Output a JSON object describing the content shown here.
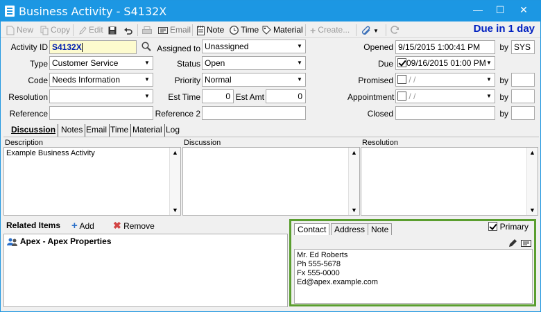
{
  "window": {
    "title": "Business Activity - S4132X",
    "minimize": "—",
    "maximize": "☐",
    "close": "✕"
  },
  "toolbar": {
    "new": "New",
    "copy": "Copy",
    "edit": "Edit",
    "email": "Email",
    "note": "Note",
    "time": "Time",
    "material": "Material",
    "create": "Create...",
    "due_banner": "Due in 1 day"
  },
  "form": {
    "activity_id": {
      "label": "Activity ID",
      "value": "S4132X"
    },
    "type": {
      "label": "Type",
      "value": "Customer Service"
    },
    "code": {
      "label": "Code",
      "value": "Needs Information"
    },
    "resolution": {
      "label": "Resolution",
      "value": ""
    },
    "reference": {
      "label": "Reference",
      "value": ""
    },
    "assigned_to": {
      "label": "Assigned to",
      "value": "Unassigned"
    },
    "status": {
      "label": "Status",
      "value": "Open"
    },
    "priority": {
      "label": "Priority",
      "value": "Normal"
    },
    "est_time": {
      "label": "Est Time",
      "value": "0"
    },
    "est_amt": {
      "label": "Est Amt",
      "value": "0"
    },
    "reference2": {
      "label": "Reference 2",
      "value": ""
    },
    "opened": {
      "label": "Opened",
      "value": "9/15/2015 1:00:41 PM",
      "by_label": "by",
      "by": "SYS"
    },
    "due": {
      "label": "Due",
      "value": "09/16/2015 01:00 PM",
      "checked": true
    },
    "promised": {
      "label": "Promised",
      "value": " /  /",
      "by_label": "by",
      "by": ""
    },
    "appointment": {
      "label": "Appointment",
      "value": " /  /",
      "by_label": "by",
      "by": ""
    },
    "closed": {
      "label": "Closed",
      "value": "",
      "by_label": "by",
      "by": ""
    }
  },
  "tabs": [
    "Discussion",
    "Notes",
    "Email",
    "Time",
    "Material",
    "Log"
  ],
  "panes": {
    "description": {
      "header": "Description",
      "text": "Example Business Activity"
    },
    "discussion": {
      "header": "Discussion",
      "text": ""
    },
    "resolution": {
      "header": "Resolution",
      "text": ""
    }
  },
  "related": {
    "title": "Related Items",
    "add": "Add",
    "remove": "Remove",
    "items": [
      "Apex - Apex Properties"
    ]
  },
  "contact": {
    "tabs": [
      "Contact",
      "Address",
      "Note"
    ],
    "primary_label": "Primary",
    "primary_checked": true,
    "lines": [
      "Mr. Ed Roberts",
      "Ph 555-5678",
      "Fx 555-0000",
      "Ed@apex.example.com"
    ]
  }
}
